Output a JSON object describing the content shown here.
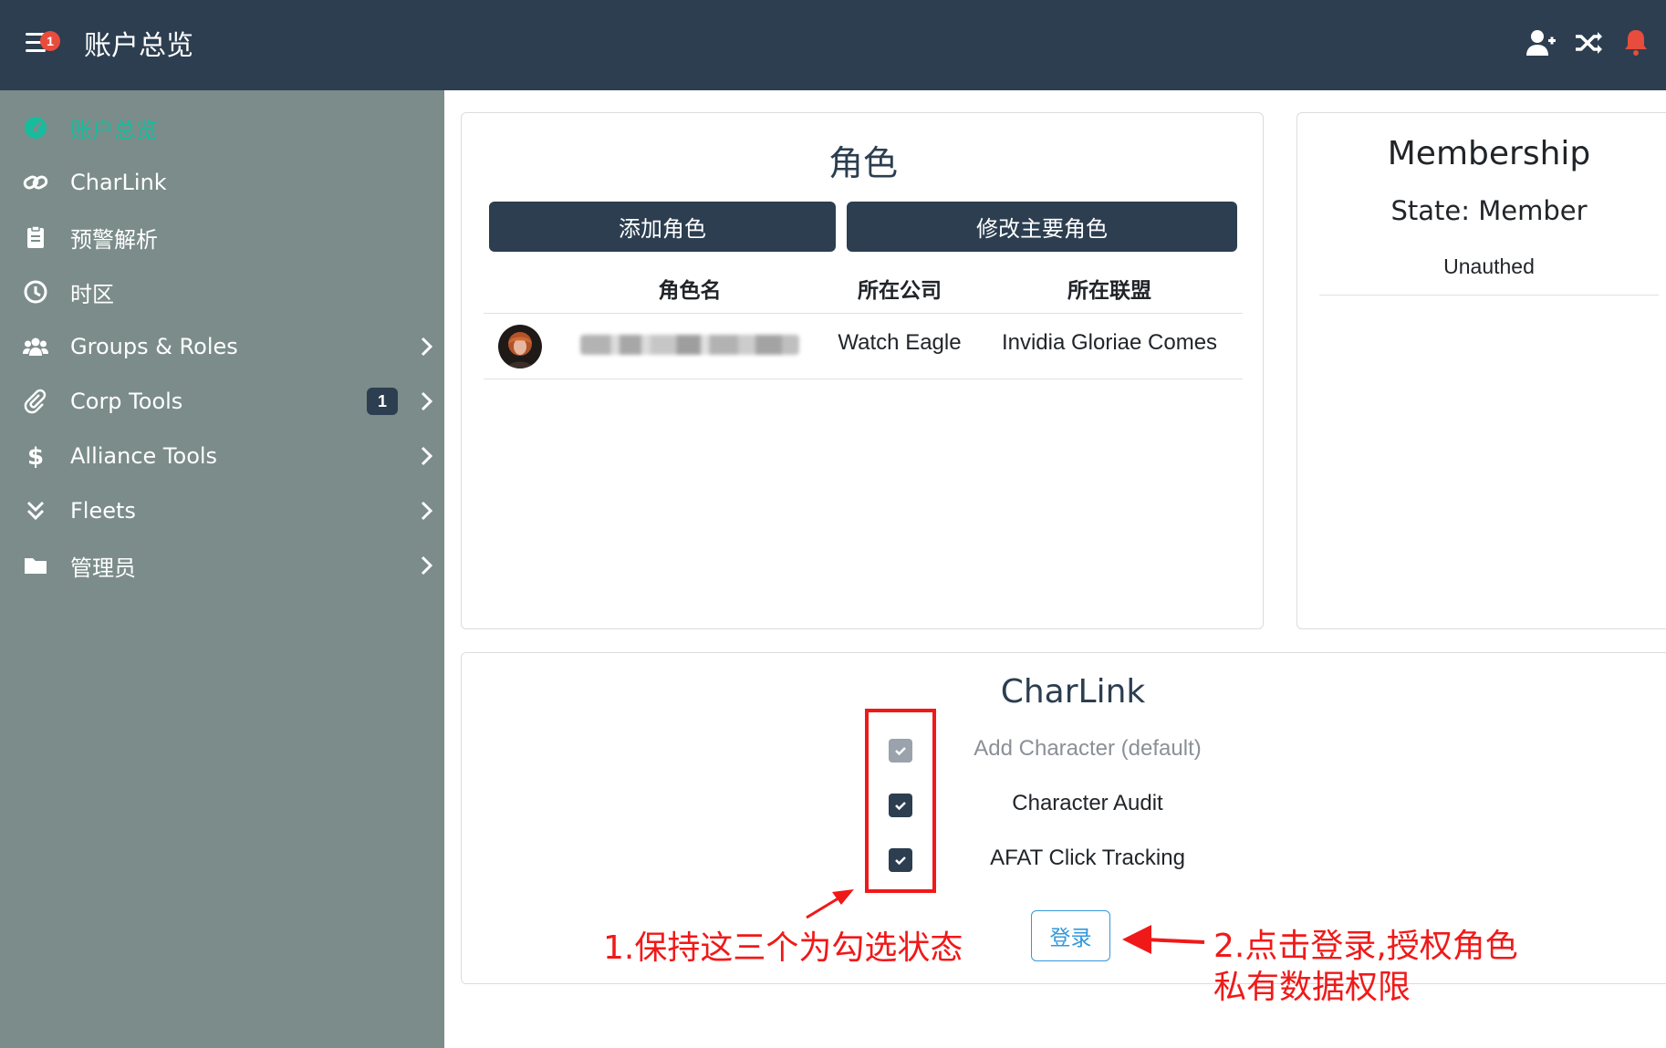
{
  "header": {
    "title": "账户总览",
    "menu_badge": "1"
  },
  "sidebar": {
    "items": [
      {
        "label": "账户总览",
        "icon": "tachometer-icon",
        "active": true
      },
      {
        "label": "CharLink",
        "icon": "link-icon"
      },
      {
        "label": "预警解析",
        "icon": "clipboard-icon"
      },
      {
        "label": "时区",
        "icon": "clock-icon"
      },
      {
        "label": "Groups & Roles",
        "icon": "users-icon",
        "expandable": true
      },
      {
        "label": "Corp Tools",
        "icon": "paperclip-icon",
        "expandable": true,
        "count": "1"
      },
      {
        "label": "Alliance Tools",
        "icon": "dollar-icon",
        "expandable": true
      },
      {
        "label": "Fleets",
        "icon": "double-chevron-down-icon",
        "expandable": true
      },
      {
        "label": "管理员",
        "icon": "folder-icon",
        "expandable": true
      }
    ]
  },
  "characters": {
    "title": "角色",
    "add_button": "添加角色",
    "change_main_button": "修改主要角色",
    "columns": [
      "角色名",
      "所在公司",
      "所在联盟"
    ],
    "rows": [
      {
        "name": "",
        "corporation": "Watch Eagle",
        "alliance": "Invidia Gloriae Comes"
      }
    ]
  },
  "membership": {
    "title": "Membership",
    "state": "State: Member",
    "status": "Unauthed"
  },
  "charlink": {
    "title": "CharLink",
    "options": [
      {
        "label": "Add Character (default)",
        "checked": true,
        "disabled": true
      },
      {
        "label": "Character Audit",
        "checked": true,
        "disabled": false
      },
      {
        "label": "AFAT Click Tracking",
        "checked": true,
        "disabled": false
      }
    ],
    "login_button": "登录"
  },
  "annotations": {
    "note1": "1.保持这三个为勾选状态",
    "note2_line1": "2.点击登录,授权角色",
    "note2_line2": "私有数据权限"
  },
  "colors": {
    "topbar": "#2c3e50",
    "sidebar": "#7b8c8a",
    "accent": "#18bc9c",
    "primary": "#2c3e50",
    "info": "#3498db",
    "annotation": "#f01919"
  }
}
